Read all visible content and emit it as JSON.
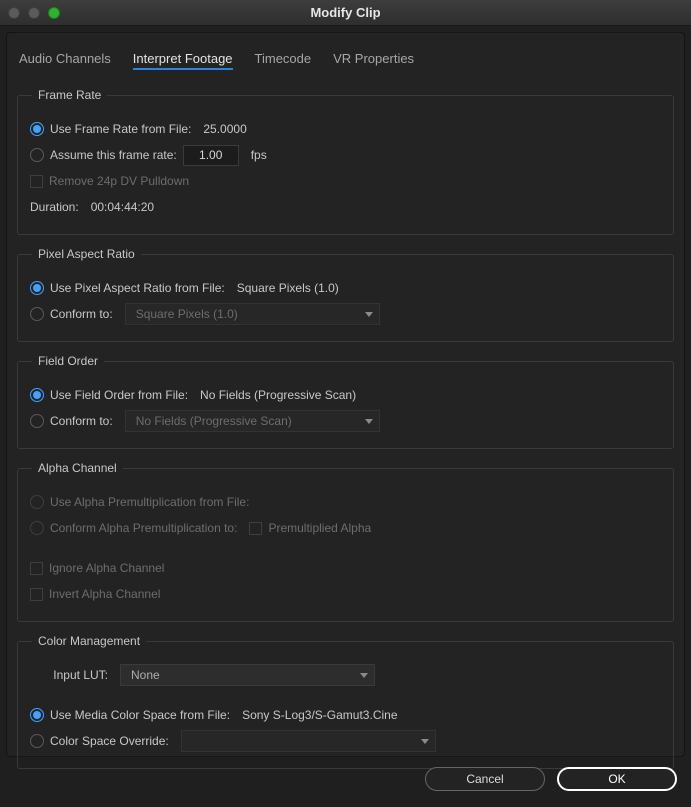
{
  "window": {
    "title": "Modify Clip"
  },
  "tabs": {
    "audio": "Audio Channels",
    "interpret": "Interpret Footage",
    "timecode": "Timecode",
    "vr": "VR Properties",
    "active": "interpret"
  },
  "frameRate": {
    "legend": "Frame Rate",
    "useFromFile": "Use Frame Rate from File:",
    "fileFps": "25.0000",
    "assume": "Assume this frame rate:",
    "assumeValue": "1.00",
    "fpsUnit": "fps",
    "removePulldown": "Remove 24p DV Pulldown",
    "durationLabel": "Duration:",
    "durationValue": "00:04:44:20"
  },
  "pixelAspect": {
    "legend": "Pixel Aspect Ratio",
    "useFromFile": "Use Pixel Aspect Ratio from File:",
    "fileValue": "Square Pixels (1.0)",
    "conform": "Conform to:",
    "conformValue": "Square Pixels (1.0)"
  },
  "fieldOrder": {
    "legend": "Field Order",
    "useFromFile": "Use Field Order from File:",
    "fileValue": "No Fields (Progressive Scan)",
    "conform": "Conform to:",
    "conformValue": "No Fields (Progressive Scan)"
  },
  "alpha": {
    "legend": "Alpha Channel",
    "useFromFile": "Use Alpha Premultiplication from File:",
    "conform": "Conform Alpha Premultiplication to:",
    "premult": "Premultiplied Alpha",
    "ignore": "Ignore Alpha Channel",
    "invert": "Invert Alpha Channel"
  },
  "color": {
    "legend": "Color Management",
    "inputLutLabel": "Input LUT:",
    "inputLutValue": "None",
    "useFromFile": "Use Media Color Space from File:",
    "fileValue": "Sony S-Log3/S-Gamut3.Cine",
    "override": "Color Space Override:",
    "overrideValue": ""
  },
  "buttons": {
    "cancel": "Cancel",
    "ok": "OK"
  }
}
